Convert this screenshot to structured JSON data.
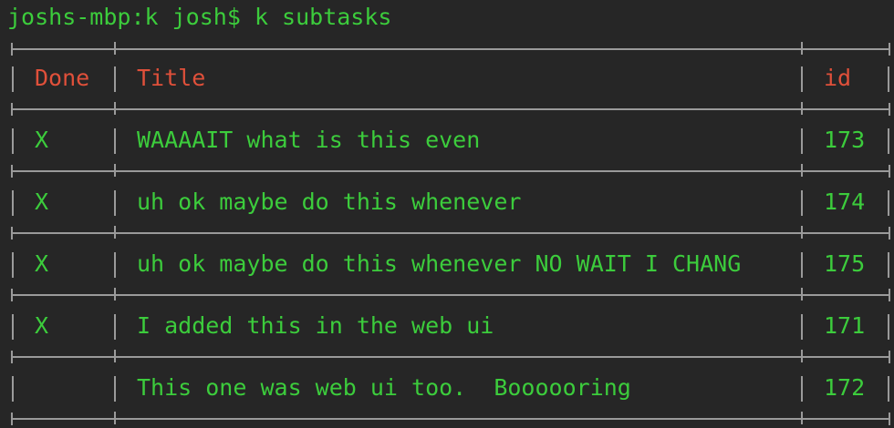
{
  "prompt": {
    "host": "joshs-mbp:k josh$",
    "command": "k subtasks"
  },
  "table": {
    "headers": {
      "done": "Done",
      "title": "Title",
      "id": "id"
    },
    "rows": [
      {
        "done": "X",
        "title": "WAAAAIT what is this even",
        "id": "173"
      },
      {
        "done": "X",
        "title": "uh ok maybe do this whenever",
        "id": "174"
      },
      {
        "done": "X",
        "title": "uh ok maybe do this whenever NO WAIT I CHANG",
        "id": "175"
      },
      {
        "done": "X",
        "title": "I added this in the web ui",
        "id": "171"
      },
      {
        "done": "",
        "title": "This one was web ui too.  Boooooring",
        "id": "172"
      }
    ]
  },
  "colors": {
    "background": "#262626",
    "text_green": "#3ccc3c",
    "header_red": "#e0503a",
    "border_gray": "#9a9a9a"
  }
}
